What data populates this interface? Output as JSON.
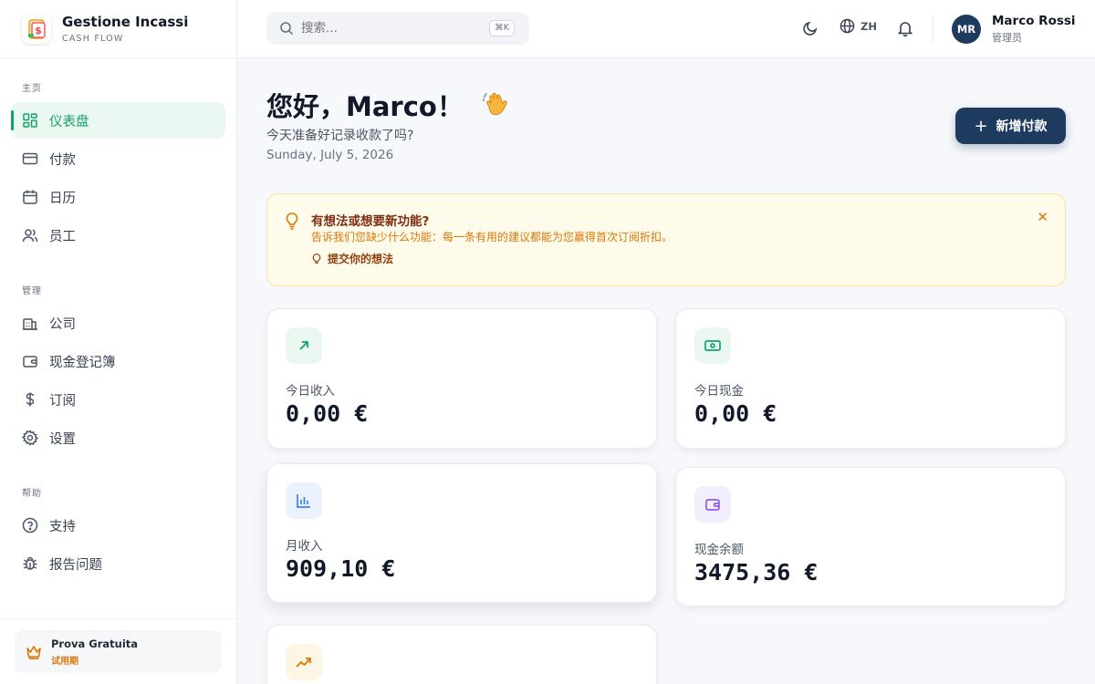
{
  "brand": {
    "name": "Gestione Incassi",
    "subtitle": "CASH FLOW"
  },
  "sidebar": {
    "sections": [
      {
        "label": "主页",
        "items": [
          {
            "label": "仪表盘",
            "icon": "dashboard-icon",
            "active": true
          },
          {
            "label": "付款",
            "icon": "credit-card-icon"
          },
          {
            "label": "日历",
            "icon": "calendar-icon"
          },
          {
            "label": "员工",
            "icon": "users-icon"
          }
        ]
      },
      {
        "label": "管理",
        "items": [
          {
            "label": "公司",
            "icon": "building-icon"
          },
          {
            "label": "现金登记簿",
            "icon": "wallet-icon"
          },
          {
            "label": "订阅",
            "icon": "dollar-icon"
          },
          {
            "label": "设置",
            "icon": "gear-icon"
          }
        ]
      },
      {
        "label": "帮助",
        "items": [
          {
            "label": "支持",
            "icon": "help-circle-icon"
          },
          {
            "label": "报告问题",
            "icon": "bug-icon"
          }
        ]
      }
    ],
    "trial": {
      "name": "Prova Gratuita",
      "status": "试用期",
      "icon": "crown-icon"
    }
  },
  "header": {
    "search": {
      "placeholder": "搜索...",
      "shortcut": "⌘K"
    },
    "language": "ZH",
    "user": {
      "initials": "MR",
      "name": "Marco Rossi",
      "role": "管理员"
    }
  },
  "main": {
    "greeting": "您好，Marco！",
    "subtitle": "今天准备好记录收款了吗?",
    "date": "Sunday, July 5, 2026",
    "new_payment_label": "新增付款",
    "banner": {
      "title": "有想法或想要新功能?",
      "text": "告诉我们您缺少什么功能：每一条有用的建议都能为您赢得首次订阅折扣。",
      "link": "提交你的想法"
    },
    "stats": [
      {
        "label": "今日收入",
        "value": "0,00 €",
        "icon": "arrow-up-right-icon",
        "color": "#12a36a"
      },
      {
        "label": "今日现金",
        "value": "0,00 €",
        "icon": "banknote-icon",
        "color": "#12a36a"
      },
      {
        "label": "月收入",
        "value": "909,10 €",
        "icon": "bar-chart-icon",
        "color": "#3b82f6"
      },
      {
        "label": "现金余额",
        "value": "3475,36 €",
        "icon": "wallet-icon",
        "color": "#8b5cf6"
      }
    ]
  },
  "colors": {
    "accent": "#12a36a",
    "primary": "#1e3a5f",
    "warning": "#d97706"
  }
}
